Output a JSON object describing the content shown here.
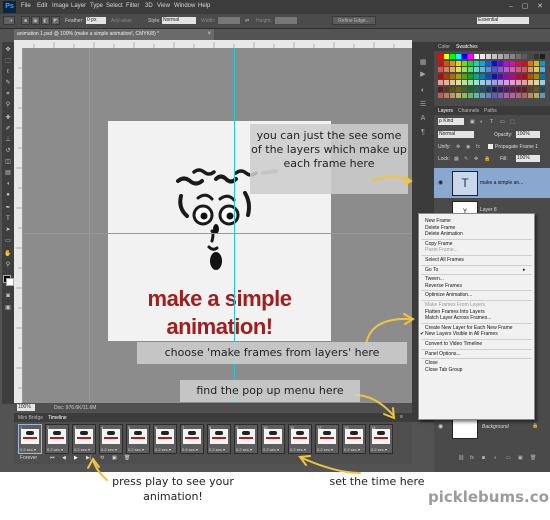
{
  "app": {
    "logo": "Ps"
  },
  "menubar": {
    "items": [
      "File",
      "Edit",
      "Image",
      "Layer",
      "Type",
      "Select",
      "Filter",
      "3D",
      "View",
      "Window",
      "Help"
    ],
    "win": [
      "–",
      "▢",
      "✕"
    ]
  },
  "options": {
    "feather_label": "Feather:",
    "feather_value": "0 px",
    "antialias": "Anti-alias",
    "style_label": "Style:",
    "style_value": "Normal",
    "width_label": "Width:",
    "height_label": "Height:",
    "refine": "Refine Edge...",
    "workspace": "Essential"
  },
  "document": {
    "tab": "animation 1.psd @ 100% (make a simple animation!, CMYK/8) *",
    "close": "×",
    "zoom": "100%",
    "doc_size": "Doc: 976.6K/11.6M"
  },
  "artwork": {
    "line1": "make a simple",
    "line2": "animation!"
  },
  "panels": {
    "top_tabs": [
      "Color",
      "Swatches"
    ],
    "layer_tabs": [
      "Layers",
      "Channels",
      "Paths"
    ],
    "filter_kind": "ρ Kind",
    "blend_mode": "Normal",
    "opacity_label": "Opacity:",
    "opacity_value": "100%",
    "unify_label": "Unify:",
    "propagate": "Propagate Frame 1",
    "lock_label": "Lock:",
    "fill_label": "Fill:",
    "fill_value": "100%",
    "layers": [
      {
        "name": "make a simple an..."
      },
      {
        "name": "Layer 8"
      },
      {
        "name": "Background"
      }
    ]
  },
  "context_menu": {
    "items": [
      {
        "label": "New Frame",
        "disabled": false
      },
      {
        "label": "Delete Frame",
        "disabled": false
      },
      {
        "label": "Delete Animation",
        "disabled": false
      },
      {
        "sep": true
      },
      {
        "label": "Copy Frame",
        "disabled": false
      },
      {
        "label": "Paste Frame...",
        "disabled": true
      },
      {
        "sep": true
      },
      {
        "label": "Select All Frames",
        "disabled": false
      },
      {
        "sep": true
      },
      {
        "label": "Go To",
        "disabled": false,
        "arrow": "▸"
      },
      {
        "sep": true
      },
      {
        "label": "Tween...",
        "disabled": false
      },
      {
        "label": "Reverse Frames",
        "disabled": false
      },
      {
        "sep": true
      },
      {
        "label": "Optimize Animation...",
        "disabled": false
      },
      {
        "sep": true
      },
      {
        "label": "Make Frames From Layers",
        "disabled": true
      },
      {
        "label": "Flatten Frames Into Layers",
        "disabled": false
      },
      {
        "label": "Match Layer Across Frames...",
        "disabled": false
      },
      {
        "sep": true
      },
      {
        "label": "Create New Layer for Each New Frame",
        "disabled": false
      },
      {
        "label": "New Layers Visible in All Frames",
        "disabled": false,
        "check": "✔"
      },
      {
        "sep": true
      },
      {
        "label": "Convert to Video Timeline",
        "disabled": false
      },
      {
        "sep": true
      },
      {
        "label": "Panel Options...",
        "disabled": false
      },
      {
        "sep": true
      },
      {
        "label": "Close",
        "disabled": false
      },
      {
        "label": "Close Tab Group",
        "disabled": false
      }
    ]
  },
  "timeline": {
    "tabs": [
      "Mini Bridge",
      "Timeline"
    ],
    "frames": [
      {
        "num": "1",
        "delay": "0.2 sec.▾"
      },
      {
        "num": "2",
        "delay": "0.2 sec.▾"
      },
      {
        "num": "3",
        "delay": "0.2 sec.▾"
      },
      {
        "num": "4",
        "delay": "0.2 sec.▾"
      },
      {
        "num": "5",
        "delay": "0.2 sec.▾"
      },
      {
        "num": "6",
        "delay": "0.2 sec.▾"
      },
      {
        "num": "7",
        "delay": "0.5 sec.▾"
      },
      {
        "num": "8",
        "delay": "0.2 sec.▾"
      },
      {
        "num": "9",
        "delay": "0.2 sec.▾"
      },
      {
        "num": "10",
        "delay": "0.2 sec.▾"
      },
      {
        "num": "11",
        "delay": "0.2 sec.▾"
      },
      {
        "num": "12",
        "delay": "0.2 sec.▾"
      },
      {
        "num": "13",
        "delay": "0.2 sec.▾"
      },
      {
        "num": "14",
        "delay": "0.2 sec.▾"
      }
    ],
    "loop": "Forever",
    "controls": [
      "⏮",
      "◀",
      "▶",
      "▶|",
      "⟲",
      "▣",
      "🗑"
    ]
  },
  "callouts": {
    "layers_note": "you can just the see some of the layers which make up each frame here",
    "choose_note": "choose 'make frames from layers' here",
    "popup_note": "find the pop up menu here",
    "play_note": "press play to see your animation!",
    "time_note": "set the time here"
  },
  "brand": {
    "text": "picklebums.com"
  }
}
